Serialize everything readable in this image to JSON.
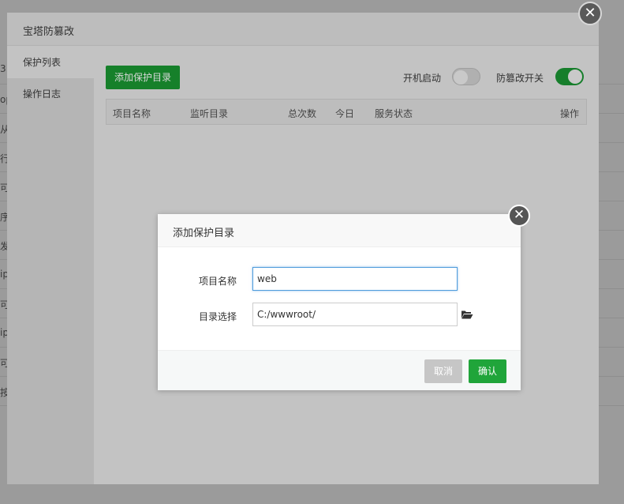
{
  "background": {
    "left_fragments": [
      "3",
      "op",
      "从",
      "行",
      "可",
      "序",
      "发",
      "ip",
      "可",
      "ip",
      "可",
      "按"
    ]
  },
  "main_window": {
    "title": "宝塔防篡改",
    "close_glyph": "✕",
    "sidebar": {
      "items": [
        {
          "label": "保护列表",
          "active": true
        },
        {
          "label": "操作日志",
          "active": false
        }
      ]
    },
    "add_button_label": "添加保护目录",
    "boot_start_label": "开机启动",
    "boot_start_on": false,
    "tamper_switch_label": "防篡改开关",
    "tamper_switch_on": true,
    "table": {
      "columns": [
        "项目名称",
        "监听目录",
        "总次数",
        "今日",
        "服务状态",
        "操作"
      ]
    }
  },
  "dialog": {
    "title": "添加保护目录",
    "close_glyph": "✕",
    "fields": {
      "name_label": "项目名称",
      "name_value": "web",
      "dir_label": "目录选择",
      "dir_value": "C:/wwwroot/"
    },
    "folder_icon": "folder-open-icon",
    "cancel_label": "取消",
    "ok_label": "确认"
  },
  "colors": {
    "accent_green": "#20a53a",
    "focus_blue": "#4e9bdc"
  }
}
